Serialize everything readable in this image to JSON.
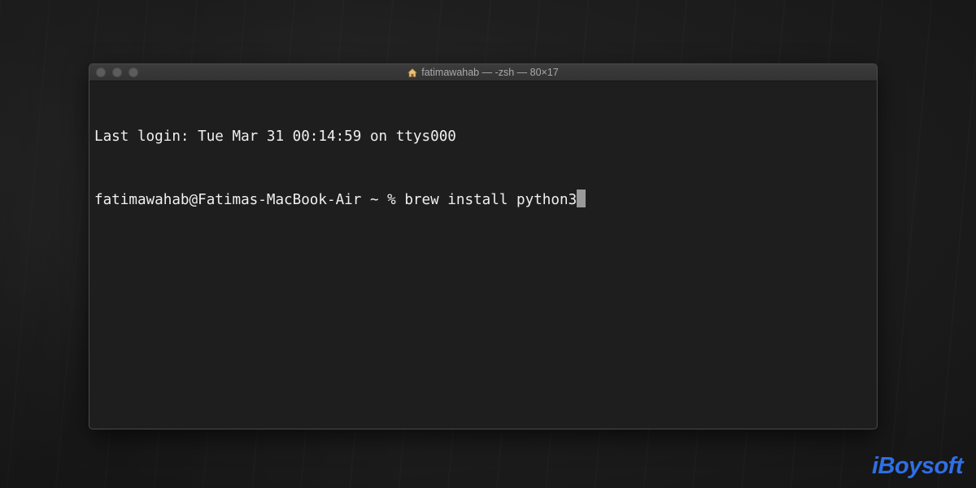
{
  "window": {
    "title": "fatimawahab — -zsh — 80×17",
    "title_icon": "home-icon"
  },
  "terminal": {
    "lines": [
      "Last login: Tue Mar 31 00:14:59 on ttys000",
      "fatimawahab@Fatimas-MacBook-Air ~ % brew install python3"
    ],
    "cursor": "block"
  },
  "watermark": {
    "text": "iBoysoft"
  },
  "colors": {
    "terminal_background": "#1e1e1e",
    "terminal_text": "#f0f0f0",
    "title_bar": "#363636",
    "logo": "#2f6fe6"
  }
}
